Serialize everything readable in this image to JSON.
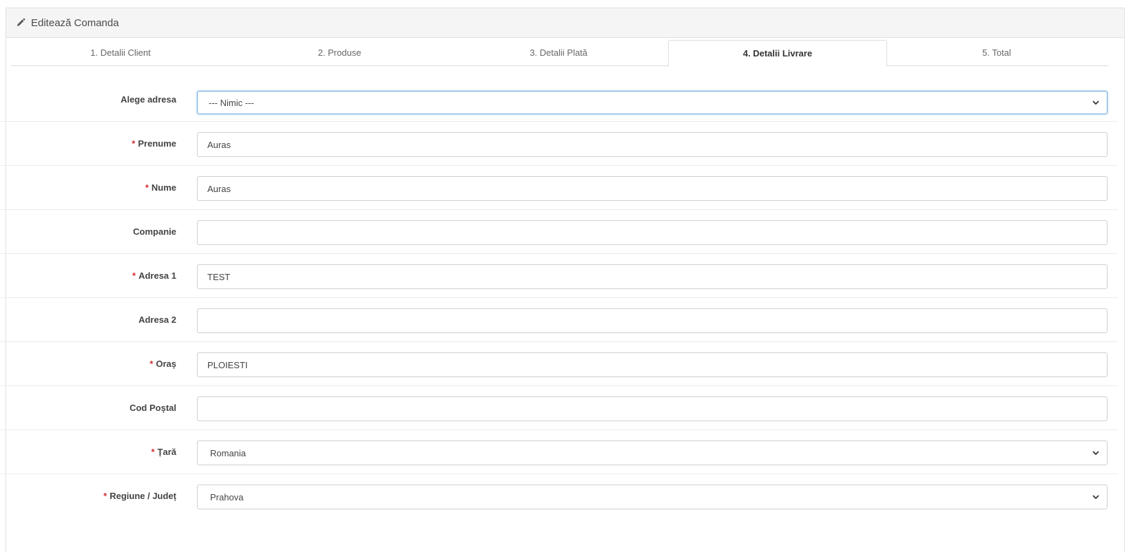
{
  "header": {
    "title": "Editează Comanda",
    "icon": "pencil-icon"
  },
  "tabs": [
    {
      "label": "1. Detalii Client",
      "active": false
    },
    {
      "label": "2. Produse",
      "active": false
    },
    {
      "label": "3. Detalii Plată",
      "active": false
    },
    {
      "label": "4. Detalii Livrare",
      "active": true
    },
    {
      "label": "5. Total",
      "active": false
    }
  ],
  "form": {
    "address_select": {
      "label": "Alege adresa",
      "value": "--- Nimic ---"
    },
    "firstname": {
      "label": "Prenume",
      "required": true,
      "value": "Auras"
    },
    "lastname": {
      "label": "Nume",
      "required": true,
      "value": "Auras"
    },
    "company": {
      "label": "Companie",
      "required": false,
      "value": ""
    },
    "address1": {
      "label": "Adresa 1",
      "required": true,
      "value": "TEST"
    },
    "address2": {
      "label": "Adresa 2",
      "required": false,
      "value": ""
    },
    "city": {
      "label": "Oraș",
      "required": true,
      "value": "PLOIESTI"
    },
    "postcode": {
      "label": "Cod Poștal",
      "required": false,
      "value": ""
    },
    "country": {
      "label": "Țară",
      "required": true,
      "value": "Romania"
    },
    "zone": {
      "label": "Regiune / Județ",
      "required": true,
      "value": "Prahova"
    }
  },
  "required_marker": "*",
  "colors": {
    "required": "#d32f2f",
    "focus_border": "#6fa8dc",
    "heading_bg": "#f5f5f5"
  }
}
